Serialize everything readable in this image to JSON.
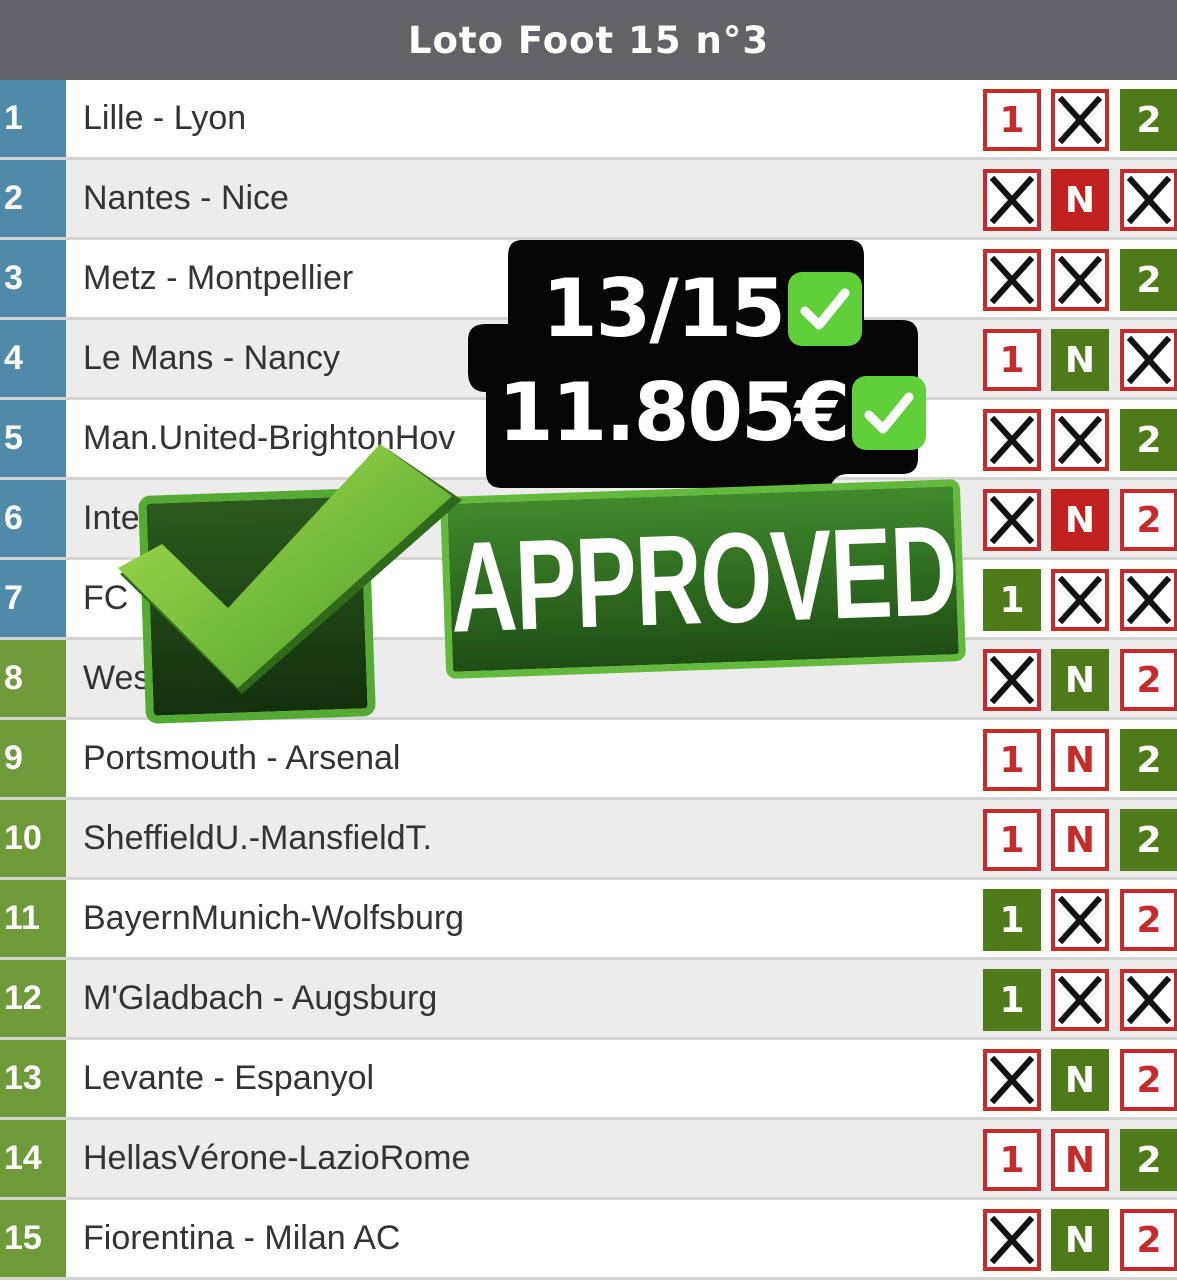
{
  "header": {
    "title": "Loto Foot 15 n°3"
  },
  "colors": {
    "header_bg": "#636267",
    "blue_num": "#4f8aa8",
    "green_num": "#6e9a3a",
    "pick_green": "#4e7a1a",
    "pick_red": "#c02020",
    "cross_red": "#c62a2a"
  },
  "rows": [
    {
      "num": "1",
      "match": "Lille - Lyon",
      "color": "blue",
      "picks": [
        "1",
        "X",
        "2"
      ],
      "styles": [
        "open-red",
        "x",
        "fill-green"
      ]
    },
    {
      "num": "2",
      "match": "Nantes - Nice",
      "color": "blue",
      "picks": [
        "X",
        "N",
        "X"
      ],
      "styles": [
        "x",
        "fill-red",
        "x"
      ]
    },
    {
      "num": "3",
      "match": "Metz - Montpellier",
      "color": "blue",
      "picks": [
        "X",
        "X",
        "2"
      ],
      "styles": [
        "x",
        "x",
        "fill-green"
      ]
    },
    {
      "num": "4",
      "match": "Le Mans - Nancy",
      "color": "blue",
      "picks": [
        "1",
        "N",
        "X"
      ],
      "styles": [
        "open-red",
        "fill-green",
        "x"
      ]
    },
    {
      "num": "5",
      "match": "Man.United-BrightonHov",
      "color": "blue",
      "picks": [
        "X",
        "X",
        "2"
      ],
      "styles": [
        "x",
        "x",
        "fill-green"
      ]
    },
    {
      "num": "6",
      "match": "Inte",
      "color": "blue",
      "picks": [
        "X",
        "N",
        "2"
      ],
      "styles": [
        "x",
        "fill-red",
        "open-red"
      ]
    },
    {
      "num": "7",
      "match": "FC",
      "color": "blue",
      "picks": [
        "1",
        "X",
        "X"
      ],
      "styles": [
        "fill-green",
        "x",
        "x"
      ]
    },
    {
      "num": "8",
      "match": "Wes",
      "color": "green",
      "picks": [
        "X",
        "N",
        "2"
      ],
      "styles": [
        "x",
        "fill-green",
        "open-red"
      ]
    },
    {
      "num": "9",
      "match": "Portsmouth - Arsenal",
      "color": "green",
      "picks": [
        "1",
        "N",
        "2"
      ],
      "styles": [
        "open-red",
        "open-red",
        "fill-green"
      ]
    },
    {
      "num": "10",
      "match": "SheffieldU.-MansfieldT.",
      "color": "green",
      "picks": [
        "1",
        "N",
        "2"
      ],
      "styles": [
        "open-red",
        "open-red",
        "fill-green"
      ]
    },
    {
      "num": "11",
      "match": "BayernMunich-Wolfsburg",
      "color": "green",
      "picks": [
        "1",
        "X",
        "2"
      ],
      "styles": [
        "fill-green",
        "x",
        "open-red"
      ]
    },
    {
      "num": "12",
      "match": "M'Gladbach - Augsburg",
      "color": "green",
      "picks": [
        "1",
        "X",
        "X"
      ],
      "styles": [
        "fill-green",
        "x",
        "x"
      ]
    },
    {
      "num": "13",
      "match": "Levante - Espanyol",
      "color": "green",
      "picks": [
        "X",
        "N",
        "2"
      ],
      "styles": [
        "x",
        "fill-green",
        "open-red"
      ]
    },
    {
      "num": "14",
      "match": "HellasVérone-LazioRome",
      "color": "green",
      "picks": [
        "1",
        "N",
        "2"
      ],
      "styles": [
        "open-red",
        "open-red",
        "fill-green"
      ]
    },
    {
      "num": "15",
      "match": "Fiorentina - Milan AC",
      "color": "green",
      "picks": [
        "X",
        "N",
        "2"
      ],
      "styles": [
        "x",
        "fill-green",
        "open-red"
      ]
    }
  ],
  "overlay": {
    "score": "13/15",
    "amount": "11.805€",
    "stamp": "APPROVED"
  }
}
